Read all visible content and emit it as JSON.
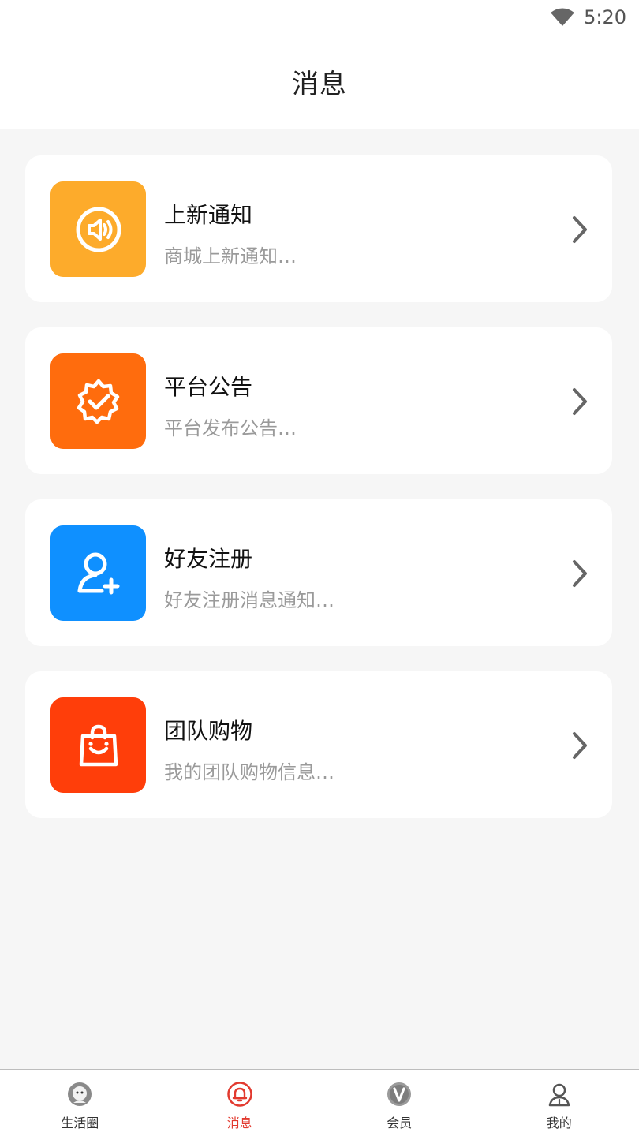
{
  "status": {
    "time": "5:20"
  },
  "header": {
    "title": "消息"
  },
  "items": [
    {
      "title": "上新通知",
      "subtitle": "商城上新通知…",
      "icon": "speaker-icon",
      "color": "#FDAB2B"
    },
    {
      "title": "平台公告",
      "subtitle": "平台发布公告…",
      "icon": "verified-badge-icon",
      "color": "#FF6C0D"
    },
    {
      "title": "好友注册",
      "subtitle": "好友注册消息通知…",
      "icon": "user-add-icon",
      "color": "#0F90FF"
    },
    {
      "title": "团队购物",
      "subtitle": "我的团队购物信息…",
      "icon": "shopping-bag-icon",
      "color": "#FF3E0A"
    }
  ],
  "tabs": [
    {
      "label": "生活圈",
      "icon": "avatar-icon"
    },
    {
      "label": "消息",
      "icon": "bell-icon",
      "active": true
    },
    {
      "label": "会员",
      "icon": "vip-icon"
    },
    {
      "label": "我的",
      "icon": "person-icon"
    }
  ],
  "colors": {
    "accent": "#e23a2f"
  }
}
